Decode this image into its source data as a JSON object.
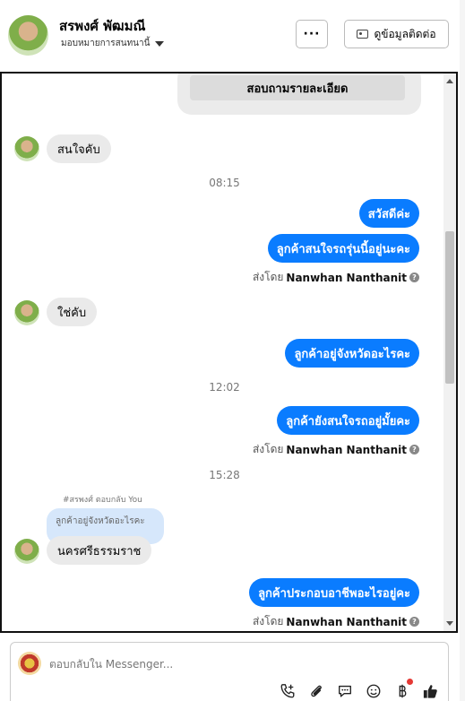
{
  "header": {
    "contact_name": "สรพงศ์ พัฒมณี",
    "status_label": "มอบหมายการสนทนานี้",
    "more_label": "···",
    "view_contact_label": "ดูข้อมูลติดต่อ"
  },
  "quick_reply": {
    "label": "สอบถามรายละเอียด"
  },
  "messages": {
    "m1": "สนใจคับ",
    "t1": "08:15",
    "m2": "สวัสดีค่ะ",
    "m3": "ลูกค้าสนใจรถรุ่นนี้อยู่นะคะ",
    "m4": "ใช่คับ",
    "m5": "ลูกค้าอยู่จังหวัดอะไรคะ",
    "t2": "12:02",
    "m6": "ลูกค้ายังสนใจรถอยู่มั้ยคะ",
    "t3": "15:28",
    "reply_note": "#สรพงศ์ ตอบกลับ You",
    "quoted": "ลูกค้าอยู่จังหวัดอะไรคะ",
    "m7": "นครศรีธรรมราช",
    "m8": "ลูกค้าประกอบอาชีพอะไรอยู่คะ"
  },
  "sent_by": {
    "prefix": "ส่งโดย",
    "agent": "Nanwhan Nanthanit"
  },
  "composer": {
    "placeholder": "ตอบกลับใน Messenger..."
  },
  "colors": {
    "accent": "#0a7cff",
    "incoming_bubble": "#eaeaea"
  }
}
